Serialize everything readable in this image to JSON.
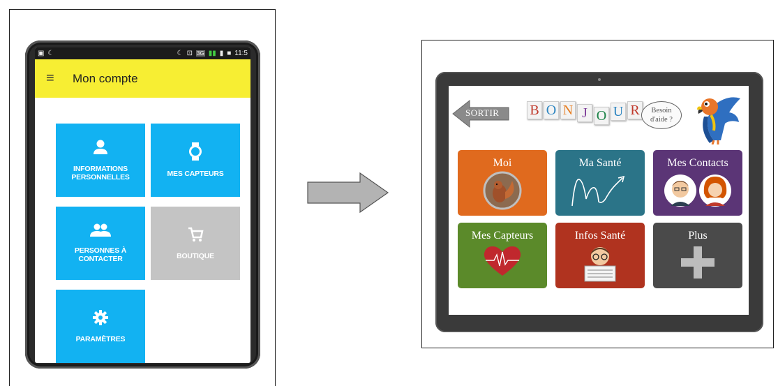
{
  "phone": {
    "status_left": [
      "▣",
      "☾"
    ],
    "status_right": [
      "☾",
      "⊡",
      "3G",
      "▮▮",
      "▮",
      "■",
      "11:5"
    ],
    "menu_icon": "hamburger-menu-icon",
    "title": "Mon compte",
    "tiles": [
      {
        "label_line1": "INFORMATIONS",
        "label_line2": "PERSONNELLES",
        "icon": "person-icon",
        "color": "#12b2f2"
      },
      {
        "label_line1": "MES CAPTEURS",
        "label_line2": "",
        "icon": "watch-icon",
        "color": "#12b2f2"
      },
      {
        "label_line1": "PERSONNES À",
        "label_line2": "CONTACTER",
        "icon": "people-icon",
        "color": "#12b2f2"
      },
      {
        "label_line1": "BOUTIQUE",
        "label_line2": "",
        "icon": "cart-icon",
        "color": "#c4c4c4"
      },
      {
        "label_line1": "PARAMÈTRES",
        "label_line2": "",
        "icon": "gear-icon",
        "color": "#12b2f2"
      }
    ]
  },
  "tablet": {
    "back_label": "SORTIR",
    "greeting_letters": [
      "B",
      "O",
      "N",
      "J",
      "O",
      "U",
      "R"
    ],
    "greeting_colors": [
      "#c0392b",
      "#2e86c1",
      "#e67e22",
      "#7d3c98",
      "#1e8449",
      "#2e86c1",
      "#c0392b"
    ],
    "help_bubble_line1": "Besoin",
    "help_bubble_line2": "d'aide ?",
    "cards": [
      {
        "label": "Moi",
        "color": "#e06a1e",
        "icon": "squirrel-photo-icon"
      },
      {
        "label": "Ma Santé",
        "color": "#2b7488",
        "icon": "health-chart-icon"
      },
      {
        "label": "Mes Contacts",
        "color": "#5b3576",
        "icon": "contacts-faces-icon"
      },
      {
        "label": "Mes Capteurs",
        "color": "#5b8a2a",
        "icon": "heartbeat-icon"
      },
      {
        "label": "Infos Santé",
        "color": "#b0331f",
        "icon": "newspaper-reader-icon"
      },
      {
        "label": "Plus",
        "color": "#4a4a4a",
        "icon": "plus-icon"
      }
    ]
  }
}
